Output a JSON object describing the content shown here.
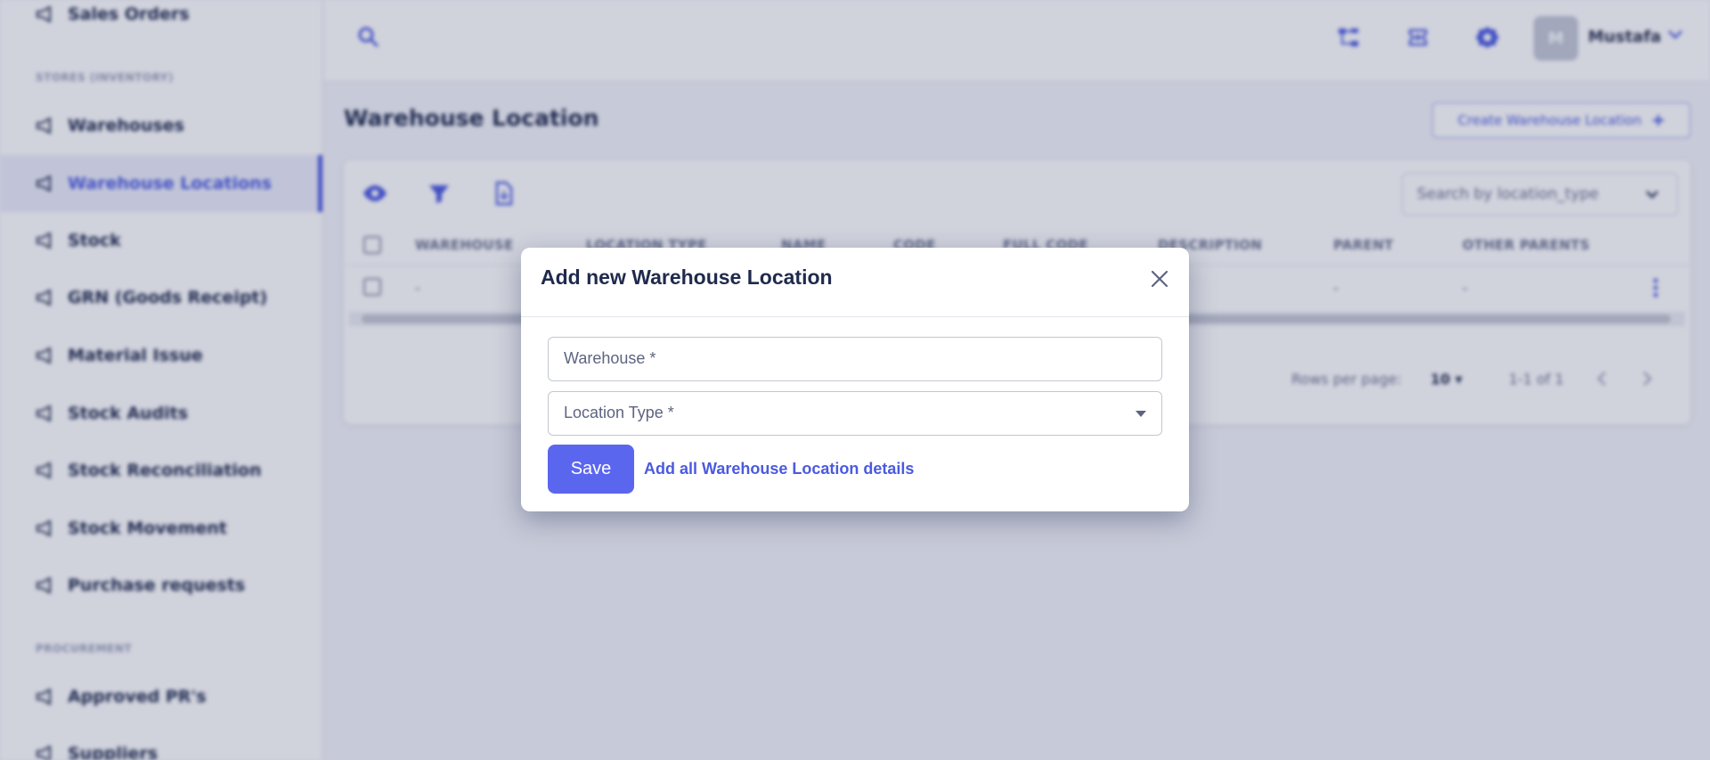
{
  "sidebar": {
    "items": [
      {
        "label": "Sales Orders"
      },
      {
        "label": "Warehouses"
      },
      {
        "label": "Warehouse Locations"
      },
      {
        "label": "Stock"
      },
      {
        "label": "GRN (Goods Receipt)"
      },
      {
        "label": "Material Issue"
      },
      {
        "label": "Stock Audits"
      },
      {
        "label": "Stock Reconciliation"
      },
      {
        "label": "Stock Movement"
      },
      {
        "label": "Purchase requests"
      },
      {
        "label": "Approved PR's"
      },
      {
        "label": "Suppliers"
      }
    ],
    "active_item": "Warehouse Locations",
    "sections": [
      "STORES (INVENTORY)",
      "PROCUREMENT"
    ]
  },
  "topbar": {
    "user_initial": "M",
    "user_name": "Mustafa",
    "icons": [
      "search-icon",
      "sitemap-icon",
      "support-icon",
      "settings-icon",
      "chevron-down-icon"
    ]
  },
  "page": {
    "title": "Warehouse Location",
    "create_button": "Create Warehouse Location",
    "search_placeholder": "Search by location_type"
  },
  "table": {
    "columns": [
      "WAREHOUSE",
      "LOCATION TYPE",
      "NAME",
      "CODE",
      "FULL CODE",
      "DESCRIPTION",
      "PARENT",
      "OTHER PARENTS"
    ],
    "rows": [
      [
        "-",
        "-",
        "-",
        "-",
        "-",
        "-",
        "-",
        "-"
      ]
    ]
  },
  "pagination": {
    "rows_per_page_label": "Rows per page:",
    "rows_per_page": "10",
    "range": "1-1 of 1"
  },
  "modal": {
    "title": "Add new Warehouse Location",
    "fields": [
      {
        "label": "Warehouse *"
      },
      {
        "label": "Location Type *"
      }
    ],
    "save_label": "Save",
    "details_link": "Add all Warehouse Location details"
  },
  "colors": {
    "accent": "#5b66ef",
    "link": "#4b5ae0",
    "title": "#1f2a4d"
  }
}
